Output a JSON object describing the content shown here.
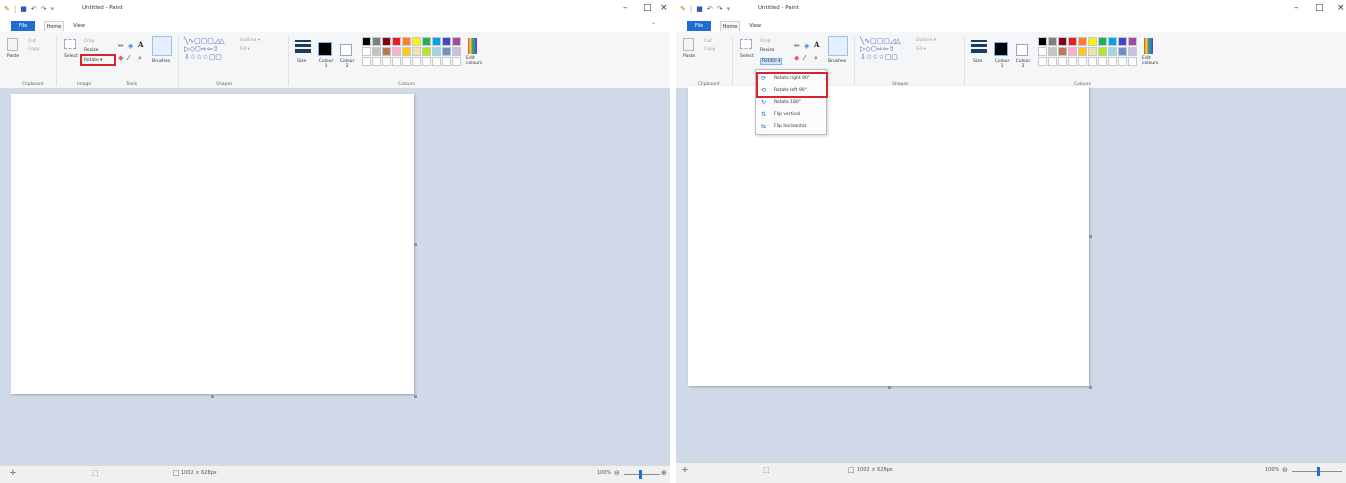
{
  "app": {
    "title": "Untitled - Paint",
    "menu": {
      "file": "File",
      "home": "Home",
      "view": "View"
    },
    "window_controls": {
      "minimize": "–",
      "maximize": "□",
      "close": "×"
    }
  },
  "ribbon": {
    "clipboard": {
      "label": "Clipboard",
      "paste": "Paste",
      "cut": "Cut",
      "copy": "Copy"
    },
    "image": {
      "label": "Image",
      "select": "Select",
      "crop": "Crop",
      "resize": "Resize",
      "rotate": "Rotate ▾"
    },
    "tools": {
      "label": "Tools"
    },
    "brushes": "Brushes",
    "shapes": {
      "label": "Shapes",
      "outline": "Outline ▾",
      "fill": "Fill ▾"
    },
    "size": "Size",
    "colours": {
      "label": "Colours",
      "colour1": "Colour 1",
      "colour2": "Colour 2",
      "edit": "Edit colours",
      "palette_row1": [
        "#000000",
        "#7f7f7f",
        "#880015",
        "#ed1c24",
        "#ff7f27",
        "#fff200",
        "#22b14c",
        "#00a2e8",
        "#3f48cc",
        "#a349a4"
      ],
      "palette_row2": [
        "#ffffff",
        "#c3c3c3",
        "#b97a57",
        "#ffaec9",
        "#ffc90e",
        "#efe4b0",
        "#b5e61d",
        "#99d9ea",
        "#7092be",
        "#c8bfe7"
      ],
      "palette_row3": [
        "#ffffff",
        "#ffffff",
        "#ffffff",
        "#ffffff",
        "#ffffff",
        "#ffffff",
        "#ffffff",
        "#ffffff",
        "#ffffff",
        "#ffffff"
      ]
    }
  },
  "rotate_menu": {
    "items": [
      {
        "label": "Rotate right 90°",
        "icon": "rotate-right-icon"
      },
      {
        "label": "Rotate left 90°",
        "icon": "rotate-left-icon"
      },
      {
        "label": "Rotate 180°",
        "icon": "rotate-180-icon"
      },
      {
        "label": "Flip vertical",
        "icon": "flip-vertical-icon"
      },
      {
        "label": "Flip horizontal",
        "icon": "flip-horizontal-icon"
      }
    ]
  },
  "status": {
    "dimensions": "1002 × 628px",
    "zoom": "100%"
  },
  "colors": {
    "accent": "#1e6fd1",
    "highlight": "#d9232d",
    "workspace": "#cfd9e8"
  }
}
